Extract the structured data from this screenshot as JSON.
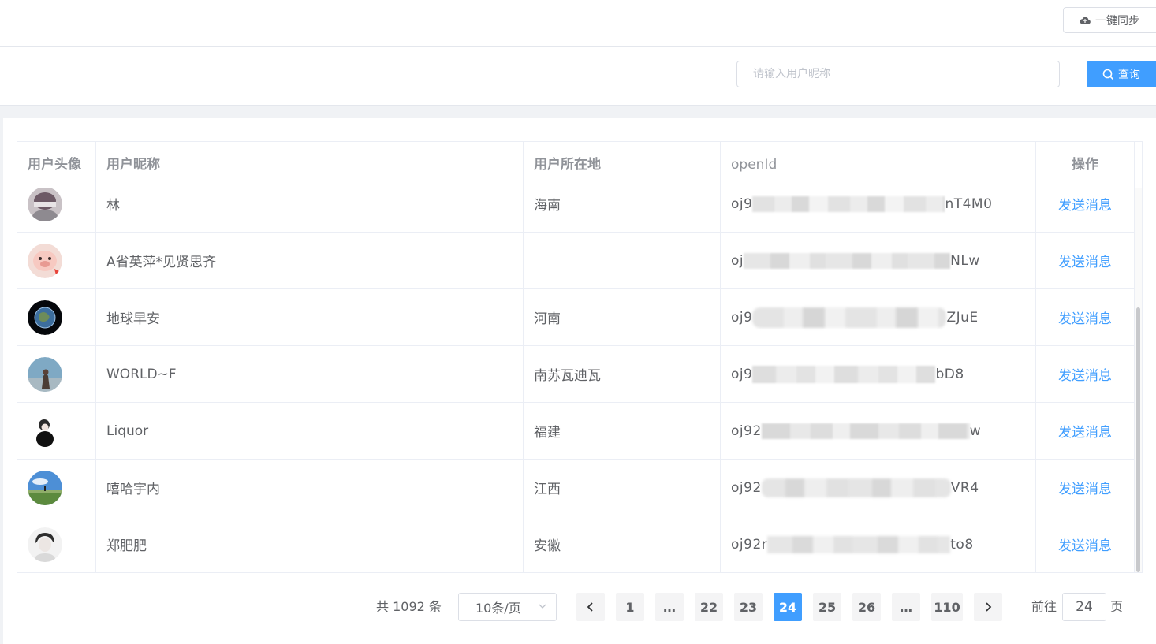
{
  "toolbar": {
    "sync_label": "一键同步",
    "sync_icon": "cloud-upload-icon"
  },
  "search": {
    "placeholder": "请输入用户昵称",
    "value": "",
    "button_label": "查询",
    "button_icon": "search-icon"
  },
  "table": {
    "headers": [
      "用户头像",
      "用户昵称",
      "用户所在地",
      "openId",
      "操作"
    ],
    "rows": [
      {
        "avatar": "avatar-photo",
        "nickname": "林",
        "location": "海南",
        "openid_prefix": "oj9",
        "openid_suffix": "nT4M0",
        "action": "发送消息"
      },
      {
        "avatar": "avatar-photo",
        "nickname": "A省英萍*见贤思齐",
        "location": "",
        "openid_prefix": "oj",
        "openid_suffix": "NLw",
        "action": "发送消息"
      },
      {
        "avatar": "avatar-photo",
        "nickname": "地球早安",
        "location": "河南",
        "openid_prefix": "oj9",
        "openid_suffix": "ZJuE",
        "action": "发送消息"
      },
      {
        "avatar": "avatar-photo",
        "nickname": "WORLD~F",
        "location": "南苏瓦迪瓦",
        "openid_prefix": "oj9",
        "openid_suffix": "bD8",
        "action": "发送消息"
      },
      {
        "avatar": "avatar-photo",
        "nickname": "Liquor",
        "location": "福建",
        "openid_prefix": "oj92",
        "openid_suffix": "w",
        "action": "发送消息"
      },
      {
        "avatar": "avatar-photo",
        "nickname": "嘻哈宇内",
        "location": "江西",
        "openid_prefix": "oj92",
        "openid_suffix": "VR4",
        "action": "发送消息"
      },
      {
        "avatar": "avatar-photo",
        "nickname": "郑肥肥",
        "location": "安徽",
        "openid_prefix": "oj92r",
        "openid_suffix": "to8",
        "action": "发送消息"
      }
    ]
  },
  "pagination": {
    "total_text": "共 1092 条",
    "page_size_text": "10条/页",
    "pages": [
      "1",
      "…",
      "22",
      "23",
      "24",
      "25",
      "26",
      "…",
      "110"
    ],
    "current_page": "24",
    "jump_prefix": "前往",
    "jump_value": "24",
    "jump_suffix": "页"
  },
  "colors": {
    "primary": "#409eff",
    "border": "#ebeef5",
    "text": "#606266",
    "header_text": "#909399"
  }
}
